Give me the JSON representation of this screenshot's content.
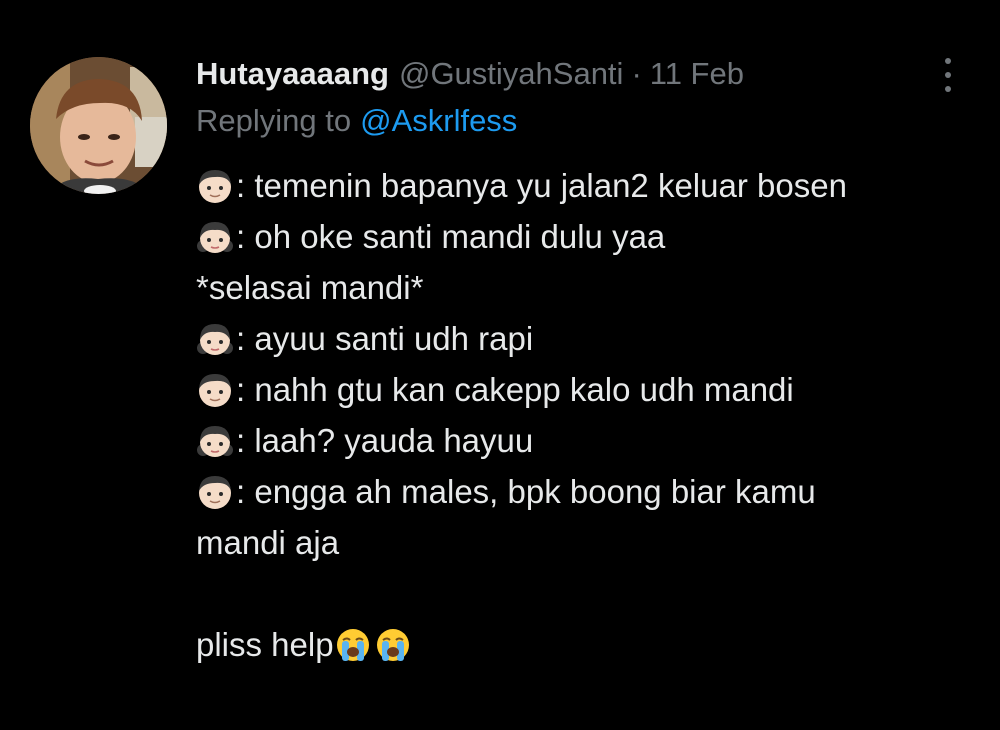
{
  "tweet": {
    "display_name": "Hutayaaaang",
    "handle": "@GustiyahSanti",
    "separator": "·",
    "date": "11 Feb",
    "replying_prefix": "Replying to",
    "replying_mention": "@Askrlfess",
    "lines": [
      {
        "emoji": "man-icon",
        "text": ": temenin bapanya yu jalan2 keluar bosen"
      },
      {
        "emoji": "girl-icon",
        "text": ": oh oke santi mandi dulu yaa"
      },
      {
        "emoji": "",
        "text": "*selasai mandi*"
      },
      {
        "emoji": "girl-icon",
        "text": ": ayuu santi udh rapi"
      },
      {
        "emoji": "man-icon",
        "text": ": nahh gtu kan cakepp kalo udh mandi"
      },
      {
        "emoji": "girl-icon",
        "text": ": laah? yauda hayuu"
      },
      {
        "emoji": "man-icon",
        "text": ": engga ah males, bpk boong biar kamu"
      },
      {
        "emoji": "",
        "text": "mandi aja"
      }
    ],
    "closing_text": "pliss help",
    "closing_emojis": [
      "loudly-crying-face-icon",
      "loudly-crying-face-icon"
    ]
  },
  "colors": {
    "background": "#000000",
    "primary_text": "#e7e9ea",
    "secondary_text": "#71767b",
    "mention": "#1d9bf0"
  }
}
